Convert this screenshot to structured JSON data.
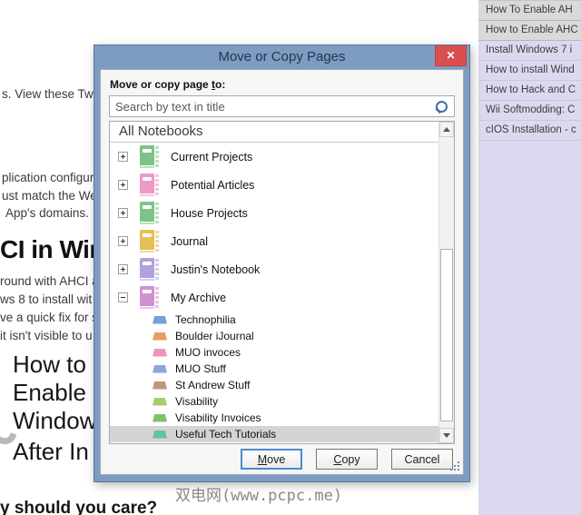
{
  "colors": {
    "titlebar": "#7e9cc1",
    "dialog-border": "#54779e",
    "close-red": "#d94f4f",
    "sidebar-bg": "#dbd9ef",
    "sidebar-active-bg": "#d9d9d9",
    "selection-bg": "#d4d4d4",
    "watermark": "#8a8a8a"
  },
  "background": {
    "watermark": "双电网(www.pcpc.me)",
    "left_page": {
      "fragments": [
        {
          "text": "s. View these Twe"
        },
        {
          "text": "plication configur"
        },
        {
          "text": "ust match the We"
        },
        {
          "text": "App's domains."
        },
        {
          "text": "CI in Wind"
        },
        {
          "text": "round with AHCI a"
        },
        {
          "text": "ws 8 to install wit"
        },
        {
          "text": "ve a quick fix for s"
        },
        {
          "text": "it isn't visible to u"
        },
        {
          "text": "How to"
        },
        {
          "text": "Enable"
        },
        {
          "text": "Window"
        },
        {
          "text": "After In"
        },
        {
          "text": "y should you care?"
        }
      ]
    },
    "sidebar": {
      "items": [
        {
          "label": "How To Enable AH",
          "active": true
        },
        {
          "label": "How to Enable AHC",
          "active": true
        },
        {
          "label": "Install Windows 7 i",
          "active": false
        },
        {
          "label": "How to install Wind",
          "active": false
        },
        {
          "label": "How to Hack and C",
          "active": false
        },
        {
          "label": "Wii Softmodding: C",
          "active": false
        },
        {
          "label": "cIOS Installation - c",
          "active": false
        }
      ]
    }
  },
  "dialog": {
    "title": "Move or Copy Pages",
    "close_glyph": "✕",
    "label": {
      "pre": "Move or copy page ",
      "u": "t",
      "post": "o:"
    },
    "search": {
      "placeholder": "Search by text in title"
    },
    "tree": {
      "header": "All Notebooks",
      "notebooks": [
        {
          "label": "Current Projects",
          "color": "#7dc387",
          "light": "#b9e2bd",
          "expanded": false
        },
        {
          "label": "Potential Articles",
          "color": "#ee9ac6",
          "light": "#f6c6de",
          "expanded": false
        },
        {
          "label": "House Projects",
          "color": "#7dc387",
          "light": "#b9e2bd",
          "expanded": false
        },
        {
          "label": "Journal",
          "color": "#e4bf55",
          "light": "#efd9a0",
          "expanded": false
        },
        {
          "label": "Justin's Notebook",
          "color": "#b2a1dc",
          "light": "#d4cbee",
          "expanded": false
        },
        {
          "label": "My Archive",
          "color": "#cf92d0",
          "light": "#e7c6e6",
          "expanded": true,
          "sections": [
            {
              "label": "Technophilia",
              "color": "#76a0d6"
            },
            {
              "label": "Boulder iJournal",
              "color": "#ea9c60"
            },
            {
              "label": "MUO invoces",
              "color": "#ee93c3"
            },
            {
              "label": "MUO Stuff",
              "color": "#8aa6dc"
            },
            {
              "label": "St Andrew Stuff",
              "color": "#bd9878"
            },
            {
              "label": "Visability",
              "color": "#a5cd68"
            },
            {
              "label": "Visability Invoices",
              "color": "#7fc365"
            },
            {
              "label": "Useful Tech Tutorials",
              "color": "#5fc2a4",
              "selected": true
            }
          ]
        }
      ]
    },
    "buttons": [
      {
        "pre": "",
        "u": "M",
        "post": "ove",
        "default": true
      },
      {
        "pre": "",
        "u": "C",
        "post": "opy",
        "default": false
      },
      {
        "pre": "Cancel",
        "u": "",
        "post": "",
        "default": false
      }
    ]
  }
}
